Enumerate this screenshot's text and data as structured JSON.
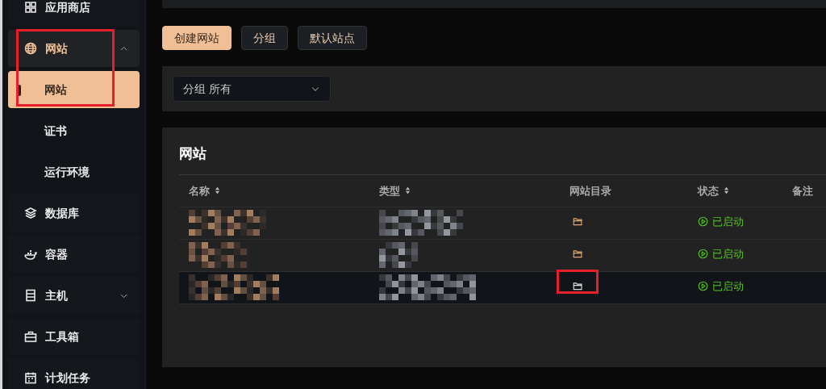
{
  "sidebar": {
    "items": [
      {
        "label": "应用商店",
        "highlighted": false
      },
      {
        "label": "网站",
        "expanded": true,
        "highlighted": true,
        "children": [
          {
            "label": "网站",
            "selected": true
          },
          {
            "label": "证书",
            "selected": false
          },
          {
            "label": "运行环境",
            "selected": false
          }
        ]
      },
      {
        "label": "数据库",
        "highlighted": false
      },
      {
        "label": "容器",
        "highlighted": false
      },
      {
        "label": "主机",
        "expanded": false,
        "highlighted": false
      },
      {
        "label": "工具箱",
        "highlighted": false
      },
      {
        "label": "计划任务",
        "highlighted": false
      }
    ]
  },
  "toolbar": {
    "buttons": [
      {
        "label": "创建网站",
        "primary": true
      },
      {
        "label": "分组",
        "primary": false
      },
      {
        "label": "默认站点",
        "primary": false
      }
    ]
  },
  "filter": {
    "label": "分组",
    "value": "所有"
  },
  "card": {
    "title": "网站",
    "table": {
      "columns": [
        {
          "label": "名称",
          "sortable": true
        },
        {
          "label": "类型",
          "sortable": true
        },
        {
          "label": "网站目录",
          "sortable": false
        },
        {
          "label": "状态",
          "sortable": true
        },
        {
          "label": "备注",
          "sortable": false
        }
      ],
      "rows": [
        {
          "status": "已启动",
          "hovered": false,
          "folder_highlighted": false
        },
        {
          "status": "已启动",
          "hovered": false,
          "folder_highlighted": false
        },
        {
          "status": "已启动",
          "hovered": true,
          "folder_highlighted": true
        }
      ]
    }
  }
}
